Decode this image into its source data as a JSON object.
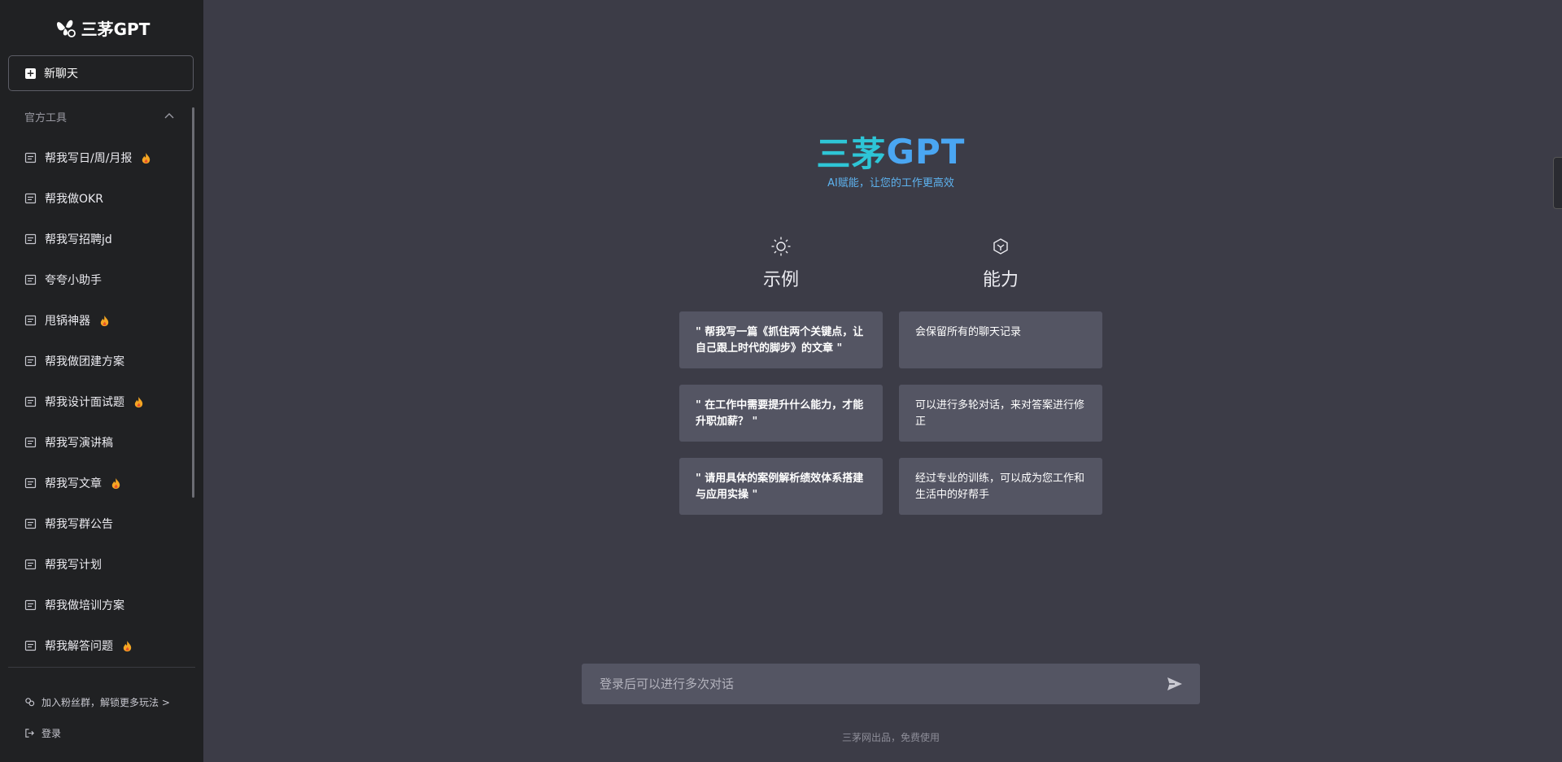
{
  "brand": {
    "name": "三茅GPT"
  },
  "sidebar": {
    "new_chat_label": "新聊天",
    "section_title": "官方工具",
    "tools": [
      {
        "label": "帮我写日/周/月报",
        "hot": true
      },
      {
        "label": "帮我做OKR",
        "hot": false
      },
      {
        "label": "帮我写招聘jd",
        "hot": false
      },
      {
        "label": "夸夸小助手",
        "hot": false
      },
      {
        "label": "甩锅神器",
        "hot": true
      },
      {
        "label": "帮我做团建方案",
        "hot": false
      },
      {
        "label": "帮我设计面试题",
        "hot": true
      },
      {
        "label": "帮我写演讲稿",
        "hot": false
      },
      {
        "label": "帮我写文章",
        "hot": true
      },
      {
        "label": "帮我写群公告",
        "hot": false
      },
      {
        "label": "帮我写计划",
        "hot": false
      },
      {
        "label": "帮我做培训方案",
        "hot": false
      },
      {
        "label": "帮我解答问题",
        "hot": true
      }
    ],
    "fan_group_label": "加入粉丝群，解锁更多玩法 >",
    "login_label": "登录"
  },
  "hero": {
    "title_cn": "三茅",
    "title_en": "GPT",
    "subtitle": "AI赋能，让您的工作更高效"
  },
  "examples": {
    "heading": "示例",
    "icon": "sun-icon",
    "items": [
      "\" 帮我写一篇《抓住两个关键点，让自己跟上时代的脚步》的文章 \"",
      "\" 在工作中需要提升什么能力，才能升职加薪？ \"",
      "\" 请用具体的案例解析绩效体系搭建与应用实操 \""
    ]
  },
  "capabilities": {
    "heading": "能力",
    "icon": "cube-icon",
    "items": [
      "会保留所有的聊天记录",
      "可以进行多轮对话，来对答案进行修正",
      "经过专业的训练，可以成为您工作和生活中的好帮手"
    ]
  },
  "chat": {
    "placeholder": "登录后可以进行多次对话",
    "footer": "三茅网出品，免费使用"
  },
  "colors": {
    "sidebar_bg": "#202123",
    "main_bg": "#3c3c47",
    "card_bg": "#545563",
    "title_cyan": "#2ec5d6",
    "title_blue": "#4aa6f2",
    "fire": "#f5a623"
  }
}
